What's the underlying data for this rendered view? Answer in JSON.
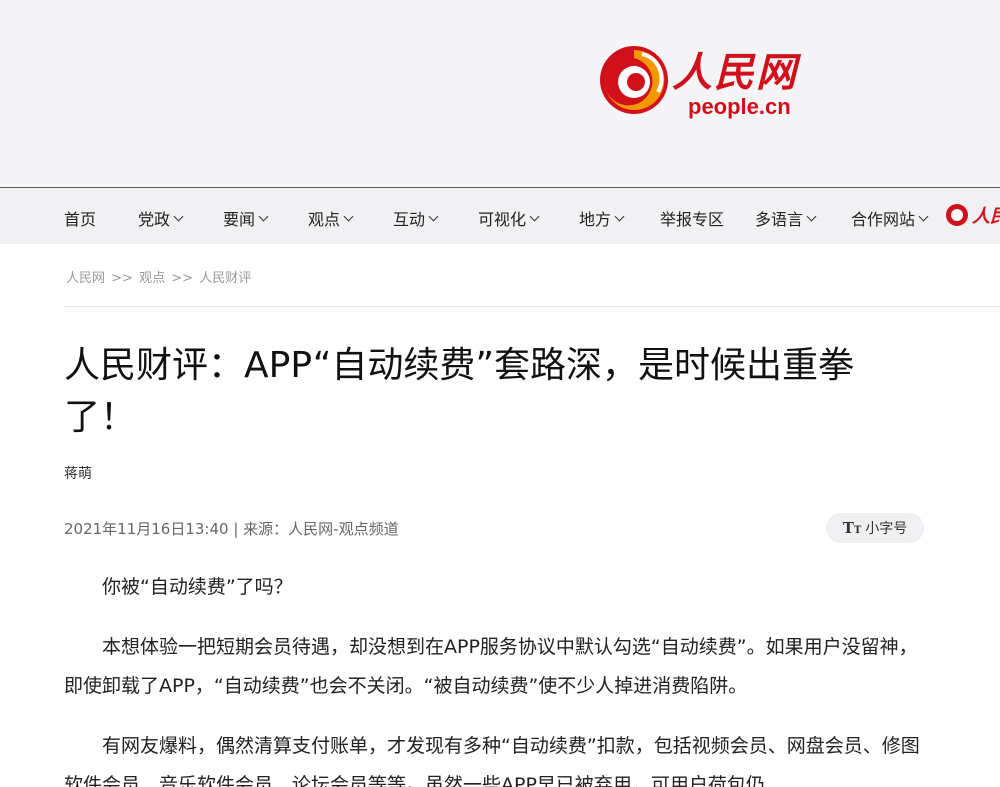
{
  "logo": {
    "cn": "人民网",
    "en": "people.cn"
  },
  "nav": {
    "items": [
      {
        "label": "首页",
        "dropdown": false
      },
      {
        "label": "党政",
        "dropdown": true
      },
      {
        "label": "要闻",
        "dropdown": true
      },
      {
        "label": "观点",
        "dropdown": true
      },
      {
        "label": "互动",
        "dropdown": true
      },
      {
        "label": "可视化",
        "dropdown": true
      },
      {
        "label": "地方",
        "dropdown": true
      },
      {
        "label": "举报专区",
        "dropdown": false
      },
      {
        "label": "多语言",
        "dropdown": true
      },
      {
        "label": "合作网站",
        "dropdown": true
      }
    ],
    "logo_text": "人民"
  },
  "breadcrumb": {
    "items": [
      "人民网",
      "观点",
      "人民财评"
    ],
    "sep": ">>"
  },
  "article": {
    "title": "人民财评：APP“自动续费”套路深，是时候出重拳了！",
    "author": "蒋萌",
    "meta": "2021年11月16日13:40 | 来源：人民网-观点频道",
    "font_toggle_label": "小字号",
    "paragraphs": [
      "你被“自动续费”了吗？",
      "本想体验一把短期会员待遇，却没想到在APP服务协议中默认勾选“自动续费”。如果用户没留神，即使卸载了APP，“自动续费”也会不关闭。“被自动续费”使不少人掉进消费陷阱。",
      "有网友爆料，偶然清算支付账单，才发现有多种“自动续费”扣款，包括视频会员、网盘会员、修图软件会员、音乐软件会员、论坛会员等等。虽然一些APP早已被弃用，可用户荷包仍"
    ]
  },
  "colors": {
    "brand_red": "#d0111b"
  }
}
